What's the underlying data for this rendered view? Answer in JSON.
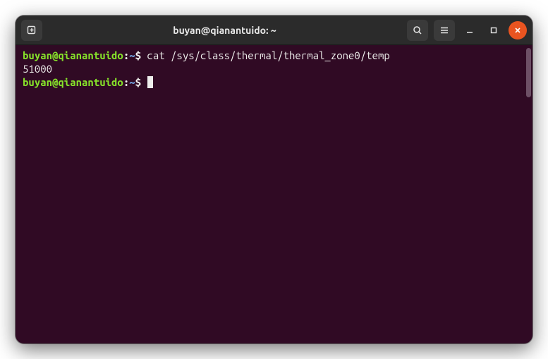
{
  "window": {
    "title": "buyan@qianantuido: ~"
  },
  "titlebar_icons": {
    "newtab": "new-tab-icon",
    "search": "search-icon",
    "menu": "hamburger-icon",
    "minimize": "minimize-icon",
    "maximize": "maximize-icon",
    "close": "close-icon"
  },
  "terminal": {
    "lines": [
      {
        "type": "prompt",
        "user_host": "buyan@qianantuido",
        "separator": ":",
        "path": "~",
        "dollar": "$",
        "command": " cat /sys/class/thermal/thermal_zone0/temp"
      },
      {
        "type": "output",
        "text": "51000"
      },
      {
        "type": "prompt",
        "user_host": "buyan@qianantuido",
        "separator": ":",
        "path": "~",
        "dollar": "$",
        "command": " ",
        "cursor": true
      }
    ]
  }
}
